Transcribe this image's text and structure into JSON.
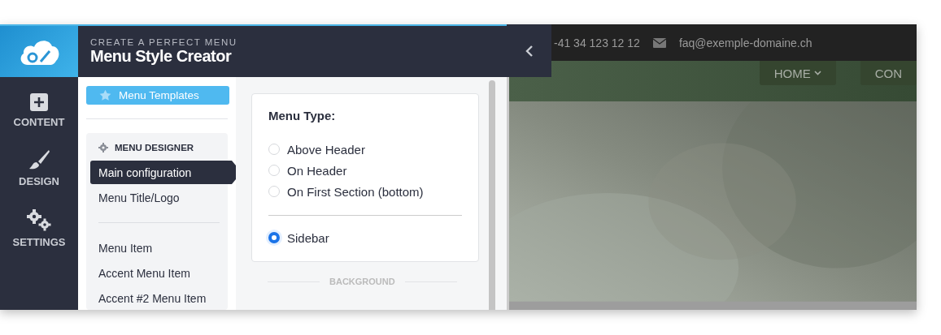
{
  "sidebar": {
    "items": [
      {
        "label": "CONTENT",
        "selected": false
      },
      {
        "label": "DESIGN",
        "selected": false
      },
      {
        "label": "SETTINGS",
        "selected": false
      }
    ]
  },
  "header": {
    "subtitle": "CREATE A PERFECT MENU",
    "title": "Menu Style Creator"
  },
  "templates_button": "Menu Templates",
  "designer": {
    "title": "MENU DESIGNER",
    "groups": [
      {
        "items": [
          {
            "label": "Main configuration",
            "selected": true
          },
          {
            "label": "Menu Title/Logo",
            "selected": false
          }
        ]
      },
      {
        "items": [
          {
            "label": "Menu Item",
            "selected": false
          },
          {
            "label": "Accent Menu Item",
            "selected": false
          },
          {
            "label": "Accent #2 Menu Item",
            "selected": false
          }
        ]
      }
    ]
  },
  "menu_type": {
    "label": "Menu Type:",
    "groups": [
      {
        "options": [
          {
            "label": "Above Header",
            "selected": false
          },
          {
            "label": "On Header",
            "selected": false
          },
          {
            "label": "On First Section (bottom)",
            "selected": false
          }
        ]
      },
      {
        "options": [
          {
            "label": "Sidebar",
            "selected": true
          }
        ]
      }
    ]
  },
  "section_heading": "BACKGROUND",
  "preview": {
    "phone": "-41 34 123 12 12",
    "email": "faq@exemple-domaine.ch",
    "nav": [
      "HOME",
      "CON"
    ]
  }
}
